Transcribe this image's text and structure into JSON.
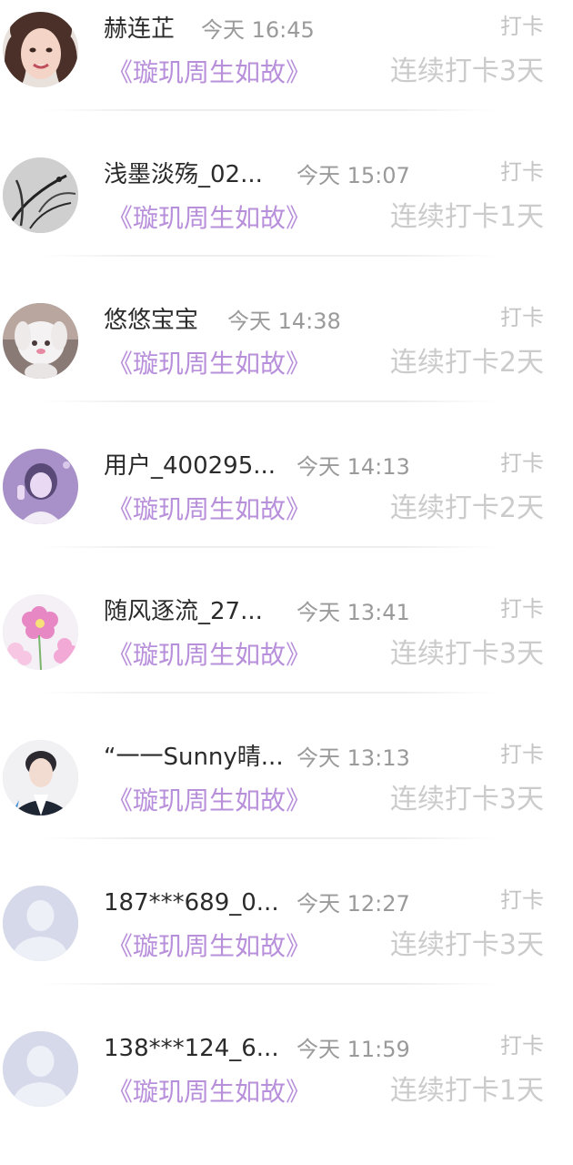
{
  "checkins": [
    {
      "name": "赫连芷",
      "time": "今天 16:45",
      "tag": "打卡",
      "book": "《璇玑周生如故》",
      "streak": "连续打卡3天",
      "avatar": "photo-woman-smiling"
    },
    {
      "name": "浅墨淡殇_02...",
      "time": "今天 15:07",
      "tag": "打卡",
      "book": "《璇玑周生如故》",
      "streak": "连续打卡1天",
      "avatar": "ink-plant-painting"
    },
    {
      "name": "悠悠宝宝",
      "time": "今天 14:38",
      "tag": "打卡",
      "book": "《璇玑周生如故》",
      "streak": "连续打卡2天",
      "avatar": "plush-toy-photo"
    },
    {
      "name": "用户_400295...",
      "time": "今天 14:13",
      "tag": "打卡",
      "book": "《璇玑周生如故》",
      "streak": "连续打卡2天",
      "avatar": "purple-girl-selfie"
    },
    {
      "name": "随风逐流_27...",
      "time": "今天 13:41",
      "tag": "打卡",
      "book": "《璇玑周生如故》",
      "streak": "连续打卡3天",
      "avatar": "pink-flowers"
    },
    {
      "name": "“一一Sunny晴...",
      "time": "今天 13:13",
      "tag": "打卡",
      "book": "《璇玑周生如故》",
      "streak": "连续打卡3天",
      "avatar": "man-portrait"
    },
    {
      "name": "187***689_0...",
      "time": "今天 12:27",
      "tag": "打卡",
      "book": "《璇玑周生如故》",
      "streak": "连续打卡3天",
      "avatar": "default-user-silhouette"
    },
    {
      "name": "138***124_6...",
      "time": "今天 11:59",
      "tag": "打卡",
      "book": "《璇玑周生如故》",
      "streak": "连续打卡1天",
      "avatar": "default-user-silhouette"
    }
  ],
  "colors": {
    "name": "#2b2b2b",
    "time": "#9a9a9a",
    "book": "#b88fdb",
    "tag": "#c4c4c4",
    "streak": "#cbcbcb",
    "divider": "#eeeeee"
  }
}
